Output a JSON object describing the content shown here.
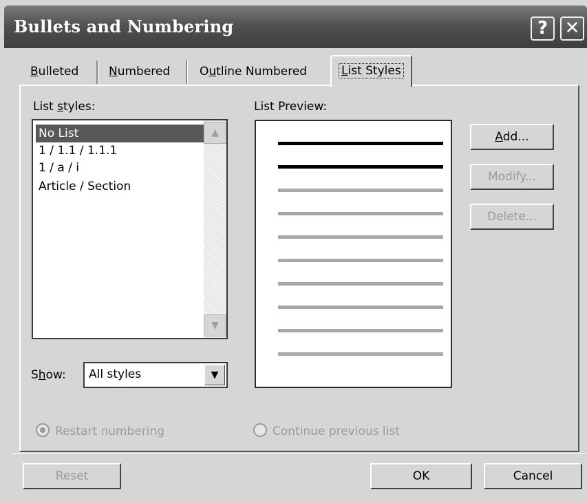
{
  "window": {
    "title": "Bullets and Numbering",
    "help_glyph": "?",
    "close_glyph": "✕"
  },
  "tabs": [
    {
      "label": "Bulleted",
      "accel_index": 0,
      "selected": false
    },
    {
      "label": "Numbered",
      "accel_index": 0,
      "selected": false
    },
    {
      "label": "Outline Numbered",
      "accel_index": 1,
      "selected": false
    },
    {
      "label": "List Styles",
      "accel_index": 0,
      "selected": true
    }
  ],
  "list_styles": {
    "label": "List styles:",
    "items": [
      "No List",
      "1 / 1.1 / 1.1.1",
      "1 / a / i",
      "Article / Section"
    ],
    "selected_index": 0,
    "scroll_up_icon": "▲",
    "scroll_down_icon": "▼"
  },
  "show": {
    "label": "Show:",
    "value": "All styles",
    "arrow": "▼"
  },
  "preview": {
    "label": "List Preview:",
    "lines": [
      "dark",
      "dark",
      "light",
      "light",
      "light",
      "light",
      "light",
      "light",
      "light",
      "light"
    ]
  },
  "buttons": {
    "add": "Add...",
    "modify": "Modify...",
    "delete": "Delete...",
    "reset": "Reset",
    "ok": "OK",
    "cancel": "Cancel"
  },
  "options": {
    "restart": "Restart numbering",
    "continue": "Continue previous list",
    "restart_checked": true,
    "continue_checked": false
  },
  "colors": {
    "title_bar": "#4e4e4e",
    "selection": "#585858",
    "dialog_bg": "#d6d6d6",
    "disabled_text": "#9a9a9a"
  }
}
